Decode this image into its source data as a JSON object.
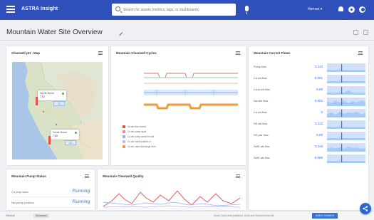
{
  "app": {
    "title": "ASTRA Insight",
    "user": "Hernan ▾"
  },
  "search": {
    "placeholder": "Search for assets (metrics, tags, or dashboards)"
  },
  "page": {
    "title": "Mountain Water Site Overview"
  },
  "cards": {
    "map": {
      "title": "Clearwell pH - Map",
      "pins": [
        {
          "label": "Ca wtr Mount",
          "value": "7.52"
        },
        {
          "label": "Ca wtr Mount",
          "value": "7.63"
        }
      ]
    },
    "cycles": {
      "title": "Mountain Clearwell Cycles",
      "legend": [
        {
          "label": "Ca wtr flow control",
          "color": "#d9534f"
        },
        {
          "label": "Ca wtr pump cycle",
          "color": "#f08d8a"
        },
        {
          "label": "Ca wtr pump control mode",
          "color": "#8fb3ee"
        },
        {
          "label": "Ca wtr valve position cl",
          "color": "#c7b8e8"
        },
        {
          "label": "Ca wtr valve discharge level",
          "color": "#f29a3a"
        }
      ]
    },
    "flows": {
      "title": "Mountain Current Flows",
      "rows": [
        {
          "label": "Pump flow",
          "value": "5.114"
        },
        {
          "label": "Ca wtr flow",
          "value": "5.091"
        },
        {
          "label": "Ca la wtr flow",
          "value": "5.09"
        },
        {
          "label": "Nw site flow",
          "value": "5.502"
        },
        {
          "label": "Ca wtr flow",
          "value": "0"
        },
        {
          "label": "NE wtr flow",
          "value": "5.112"
        },
        {
          "label": "NE pstr flow",
          "value": "5.09"
        },
        {
          "label": "SWE wtr flow",
          "value": "5.116"
        },
        {
          "label": "SWE wtr flow",
          "value": "5.099"
        }
      ]
    },
    "pump": {
      "title": "Mountain Pump Status",
      "rows": [
        {
          "label": "Ca pmp stats",
          "value": "Running"
        },
        {
          "label": "Nw pump position",
          "value": "Running"
        }
      ]
    },
    "quality": {
      "title": "Mountain Clearwell Quality"
    }
  },
  "footer": {
    "tab1": "General",
    "tab2": "Advanced",
    "message": "Some Covid were published. Undo and Restore these will",
    "button": "UNDO CHANGE"
  },
  "colors": {
    "brand": "#2f4fba",
    "accent": "#3572d4",
    "spark": "#a8cbf5"
  }
}
